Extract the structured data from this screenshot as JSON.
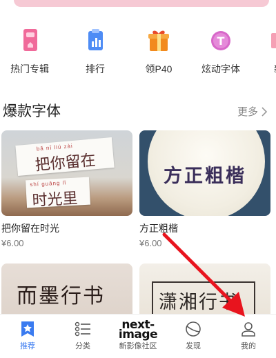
{
  "quick_nav": [
    {
      "label": "热门专辑",
      "icon": "album-icon"
    },
    {
      "label": "排行",
      "icon": "ranking-icon"
    },
    {
      "label": "领P40",
      "icon": "gift-icon"
    },
    {
      "label": "炫动字体",
      "icon": "dynamic-font-icon"
    },
    {
      "label": "新",
      "icon": "new-icon"
    }
  ],
  "section": {
    "title": "爆款字体",
    "more_label": "更多"
  },
  "cards": [
    {
      "name": "把你留在时光",
      "price": "¥6.00",
      "preview_line1": "把你留在",
      "preview_line1_pinyin": "bǎ nǐ liú zài",
      "preview_line2": "时光里",
      "preview_line2_pinyin": "shí guāng lǐ"
    },
    {
      "name": "方正粗楷",
      "price": "¥6.00",
      "preview_text": "方正粗楷"
    },
    {
      "preview_text": "而墨行书"
    },
    {
      "preview_text": "潇湘行书"
    }
  ],
  "bottom_nav": [
    {
      "label": "推荐",
      "icon": "recommend-star-icon",
      "active": true
    },
    {
      "label": "分类",
      "icon": "category-list-icon",
      "active": false
    },
    {
      "label": "新影像社区",
      "brand_top": "next-",
      "brand_bottom": "image",
      "active": false
    },
    {
      "label": "发现",
      "icon": "discover-icon",
      "active": false
    },
    {
      "label": "我的",
      "icon": "profile-icon",
      "active": false
    }
  ],
  "colors": {
    "accent": "#3a7bf0",
    "arrow": "#e8141e",
    "banner": "#f6c9d4"
  }
}
